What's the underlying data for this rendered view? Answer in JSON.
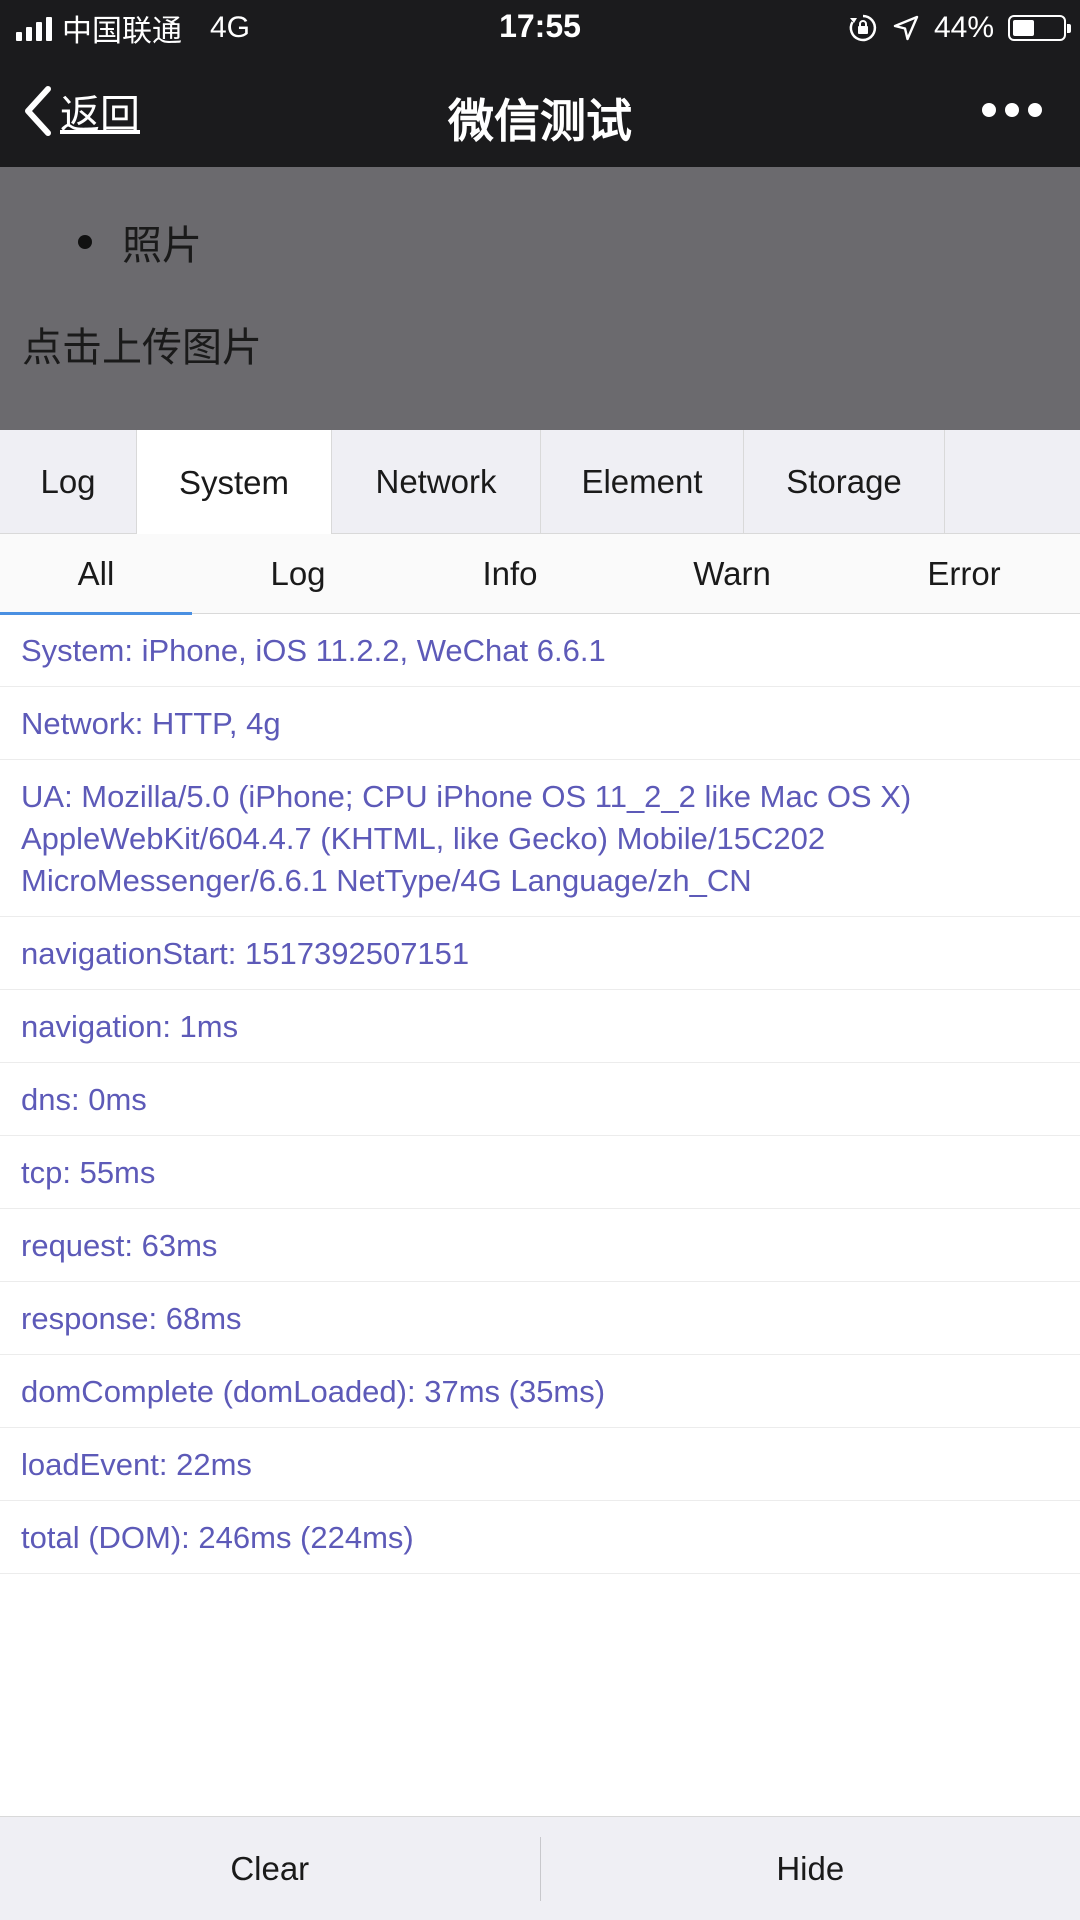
{
  "status_bar": {
    "carrier": "中国联通",
    "network_type": "4G",
    "time": "17:55",
    "battery": "44%",
    "battery_level": 0.44
  },
  "nav": {
    "back_label": "返回",
    "title": "微信测试"
  },
  "content": {
    "list_item": "照片",
    "upload_text": "点击上传图片"
  },
  "console": {
    "main_tabs": [
      {
        "label": "Log",
        "active": false
      },
      {
        "label": "System",
        "active": true
      },
      {
        "label": "Network",
        "active": false
      },
      {
        "label": "Element",
        "active": false
      },
      {
        "label": "Storage",
        "active": false
      }
    ],
    "sub_tabs": [
      {
        "label": "All",
        "active": true
      },
      {
        "label": "Log",
        "active": false
      },
      {
        "label": "Info",
        "active": false
      },
      {
        "label": "Warn",
        "active": false
      },
      {
        "label": "Error",
        "active": false
      }
    ],
    "logs": [
      "System: iPhone, iOS 11.2.2, WeChat 6.6.1",
      "Network: HTTP, 4g",
      "UA: Mozilla/5.0 (iPhone; CPU iPhone OS 11_2_2 like Mac OS X) AppleWebKit/604.4.7 (KHTML, like Gecko) Mobile/15C202 MicroMessenger/6.6.1 NetType/4G Language/zh_CN",
      "navigationStart: 1517392507151",
      "navigation: 1ms",
      "dns: 0ms",
      "tcp: 55ms",
      "request: 63ms",
      "response: 68ms",
      "domComplete (domLoaded): 37ms (35ms)",
      "loadEvent: 22ms",
      "total (DOM): 246ms (224ms)"
    ],
    "toolbar": {
      "clear_label": "Clear",
      "hide_label": "Hide"
    }
  },
  "colors": {
    "bar_bg": "#1b1b1d",
    "overlay_bg": "#6b6a6e",
    "log_text": "#5d5ab8",
    "tab_active_indicator": "#4a90e2"
  }
}
